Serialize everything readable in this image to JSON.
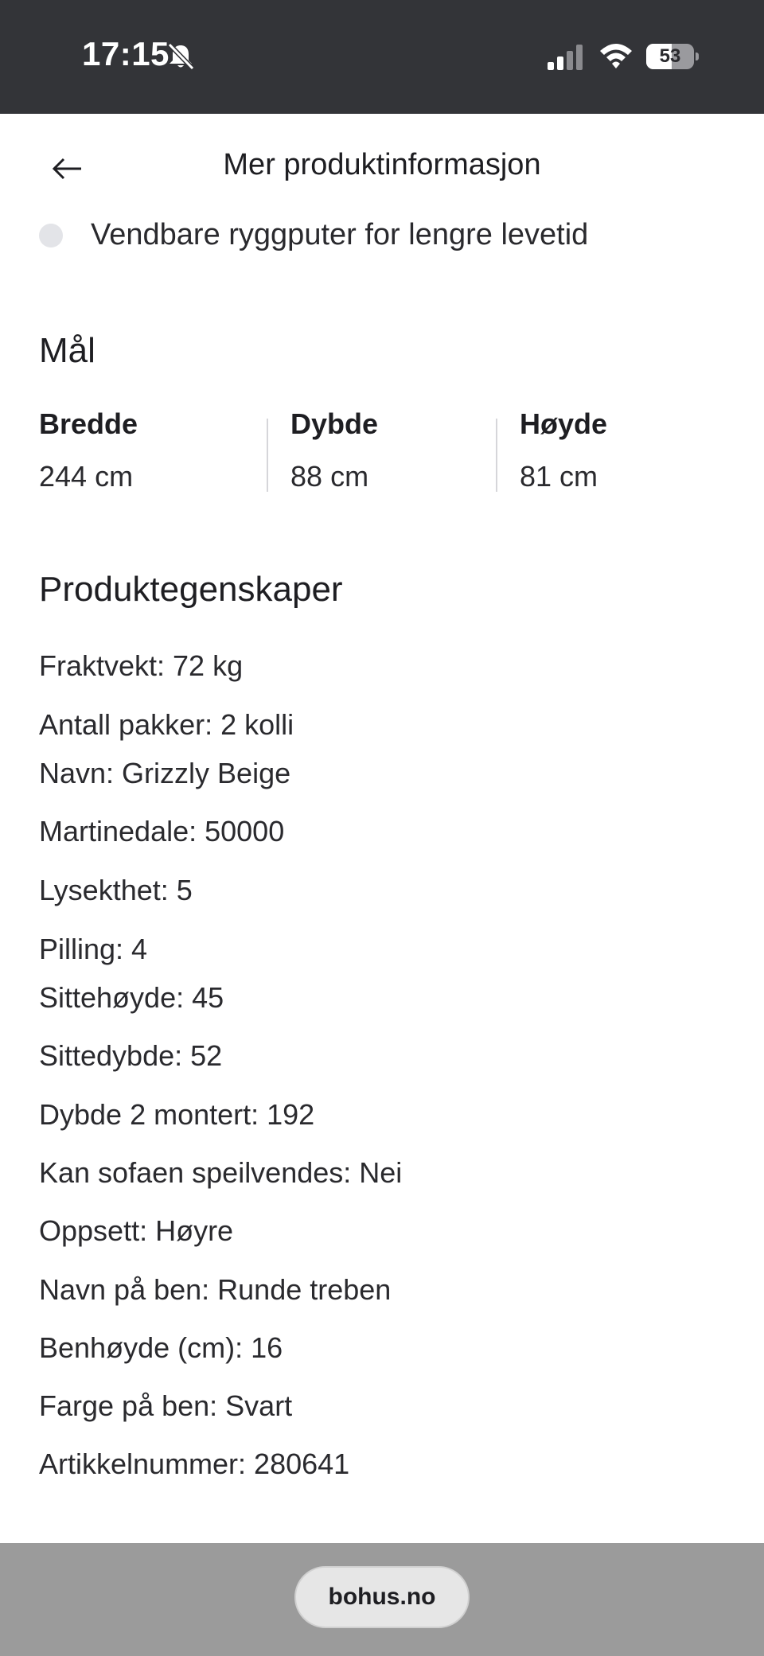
{
  "status_bar": {
    "time": "17:15",
    "battery": "53",
    "battery_level": 0.53,
    "icons": [
      "bell-off-icon",
      "signal-icon",
      "wifi-icon",
      "battery-icon"
    ]
  },
  "header": {
    "back_icon": "arrow-left-icon",
    "title": "Mer produktinformasjon"
  },
  "features": [
    "Vendbare ryggputer for lengre levetid"
  ],
  "measurements": {
    "heading": "Mål",
    "items": [
      {
        "label": "Bredde",
        "value": "244 cm"
      },
      {
        "label": "Dybde",
        "value": "88 cm"
      },
      {
        "label": "Høyde",
        "value": "81 cm"
      }
    ]
  },
  "properties": {
    "heading": "Produktegenskaper",
    "items": [
      "Fraktvekt: 72 kg",
      "Antall pakker: 2 kolli",
      "Navn: Grizzly Beige",
      "Martinedale: 50000",
      "Lysekthet: 5",
      "Pilling: 4",
      "Sittehøyde: 45",
      "Sittedybde: 52",
      "Dybde 2 montert: 192",
      "Kan sofaen speilvendes: Nei",
      "Oppsett: Høyre",
      "Navn på ben: Runde treben",
      "Benhøyde (cm): 16",
      "Farge på ben: Svart",
      "Artikkelnummer: 280641"
    ]
  },
  "browser": {
    "url": "bohus.no"
  },
  "colors": {
    "status_bar_bg": "#333438",
    "text": "#1e1e22",
    "bottom_bar_bg": "#9b9b9b"
  }
}
